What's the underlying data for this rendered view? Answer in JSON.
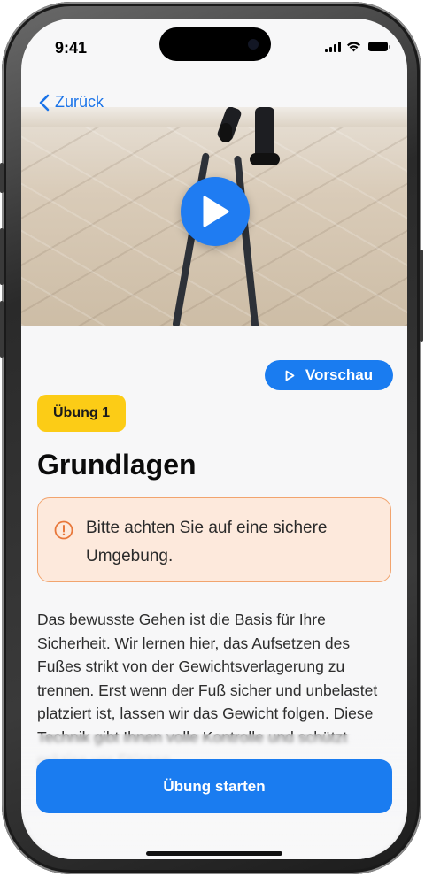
{
  "status_bar": {
    "time": "9:41",
    "icons": [
      "cellular-signal-icon",
      "wifi-icon",
      "battery-icon"
    ]
  },
  "nav": {
    "back_label": "Zurück",
    "back_icon": "chevron-left-icon"
  },
  "video": {
    "play_icon": "play-icon"
  },
  "preview_button": {
    "label": "Vorschau",
    "icon": "play-outline-icon"
  },
  "exercise": {
    "badge": "Übung 1",
    "title": "Grundlagen",
    "warning": "Bitte achten Sie auf eine sichere Umgebung.",
    "warning_icon": "exclamation-circle-icon",
    "description": "Das bewusste Gehen ist die Basis für Ihre Sicherheit. Wir lernen hier, das Aufsetzen des Fußes strikt von der Gewichtsverlagerung zu trennen. Erst wenn der Fuß sicher und unbelastet platziert ist, lassen wir das Gewicht folgen. Diese Technik gibt Ihnen volle Kontrolle und schützt präzise vor Stürzen."
  },
  "start_button": {
    "label": "Übung starten"
  },
  "colors": {
    "accent": "#1A7CF0",
    "badge": "#FCCC16",
    "warning_border": "#F2A46E",
    "warning_background": "#FDE9DC",
    "warning_icon": "#E8773A",
    "background": "#F7F7F8"
  }
}
